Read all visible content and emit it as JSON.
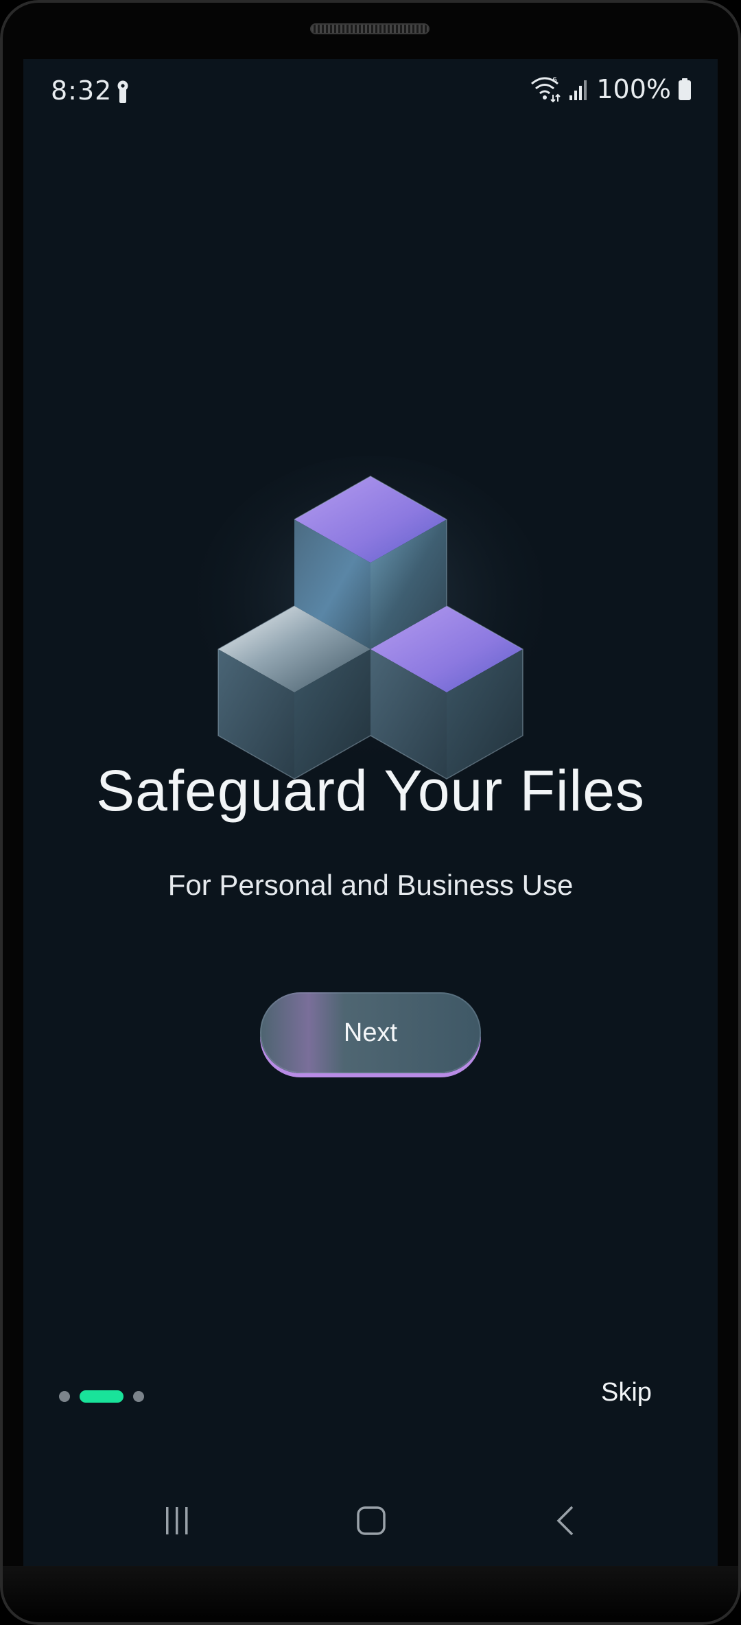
{
  "status_bar": {
    "time": "8:32",
    "battery_percent": "100%",
    "icons": [
      "key-icon",
      "wifi-icon",
      "signal-icon",
      "battery-icon"
    ]
  },
  "onboarding": {
    "illustration": "cubes-illustration",
    "title": "Safeguard Your Files",
    "subtitle": "For Personal and Business Use",
    "next_label": "Next",
    "skip_label": "Skip",
    "pager": {
      "total_pages": 3,
      "current_page": 2
    }
  },
  "navigation_bar": {
    "buttons": [
      "recent-apps-icon",
      "home-icon",
      "back-icon"
    ]
  },
  "colors": {
    "background": "#0b141c",
    "accent_green": "#19e39a",
    "accent_purple": "#b98ce6",
    "text": "#f2f5f7"
  }
}
